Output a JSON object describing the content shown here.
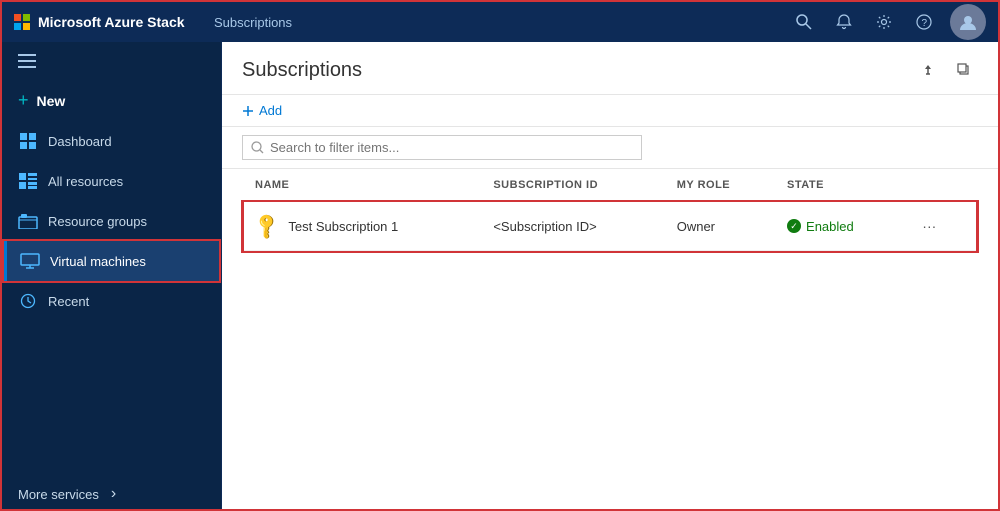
{
  "app": {
    "brand": "Microsoft Azure Stack",
    "breadcrumb": "Subscriptions"
  },
  "topbar": {
    "icons": {
      "search": "🔍",
      "bell": "🔔",
      "gear": "⚙",
      "help": "?"
    }
  },
  "sidebar": {
    "hamburger_icon": "☰",
    "new_label": "New",
    "items": [
      {
        "id": "dashboard",
        "label": "Dashboard",
        "icon": "dashboard"
      },
      {
        "id": "allresources",
        "label": "All resources",
        "icon": "allres"
      },
      {
        "id": "resourcegroups",
        "label": "Resource groups",
        "icon": "resgroup"
      },
      {
        "id": "virtualmachines",
        "label": "Virtual machines",
        "icon": "vm",
        "active": true
      },
      {
        "id": "recent",
        "label": "Recent",
        "icon": "recent"
      }
    ],
    "more_services_label": "More services",
    "more_icon": "›"
  },
  "content": {
    "title": "Subscriptions",
    "add_button": "Add",
    "search_placeholder": "Search to filter items...",
    "pin_icon": "📌",
    "restore_icon": "⬜",
    "columns": [
      "NAME",
      "SUBSCRIPTION ID",
      "MY ROLE",
      "STATE"
    ],
    "rows": [
      {
        "name": "Test Subscription 1",
        "subscription_id": "<Subscription ID>",
        "role": "Owner",
        "state": "Enabled",
        "state_enabled": true
      }
    ]
  }
}
